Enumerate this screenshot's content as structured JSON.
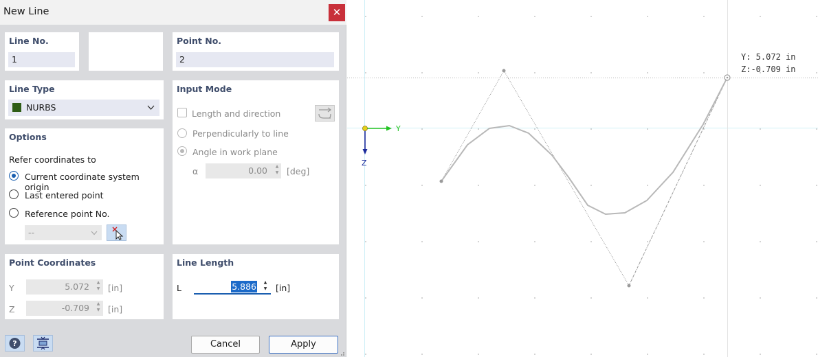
{
  "dialog": {
    "title": "New Line",
    "close_glyph": "✕"
  },
  "line_no": {
    "label": "Line No.",
    "value": "1"
  },
  "point_no": {
    "label": "Point No.",
    "value": "2"
  },
  "line_type": {
    "label": "Line Type",
    "value": "NURBS",
    "swatch_color": "#2f5d16"
  },
  "input_mode": {
    "label": "Input Mode",
    "options": [
      "Length and direction",
      "Perpendicularly to line",
      "Angle in work plane"
    ],
    "alpha_label": "α",
    "alpha_value": "0.00",
    "alpha_unit": "[deg]"
  },
  "options": {
    "label": "Options",
    "refer_label": "Refer coordinates to",
    "radios": [
      "Current coordinate system origin",
      "Last entered point",
      "Reference point No."
    ],
    "selected_index": 0,
    "ref_dropdown_value": "--"
  },
  "point_coordinates": {
    "label": "Point Coordinates",
    "y_label": "Y",
    "y_value": "5.072",
    "y_unit": "[in]",
    "z_label": "Z",
    "z_value": "-0.709",
    "z_unit": "[in]"
  },
  "line_length": {
    "label": "Line Length",
    "l_label": "L",
    "l_value": "5.886",
    "l_unit": "[in]"
  },
  "footer": {
    "cancel": "Cancel",
    "apply": "Apply"
  },
  "viewport": {
    "y_axis_label": "Y",
    "z_axis_label": "Z",
    "readout_y": "Y: 5.072 in",
    "readout_z": "Z:-0.709 in"
  },
  "colors": {
    "accent": "#1b5fb0",
    "close_red": "#c8303a",
    "panel_title": "#3f4d6b",
    "axis_y": "#22c322",
    "axis_z": "#1b2a9b"
  }
}
